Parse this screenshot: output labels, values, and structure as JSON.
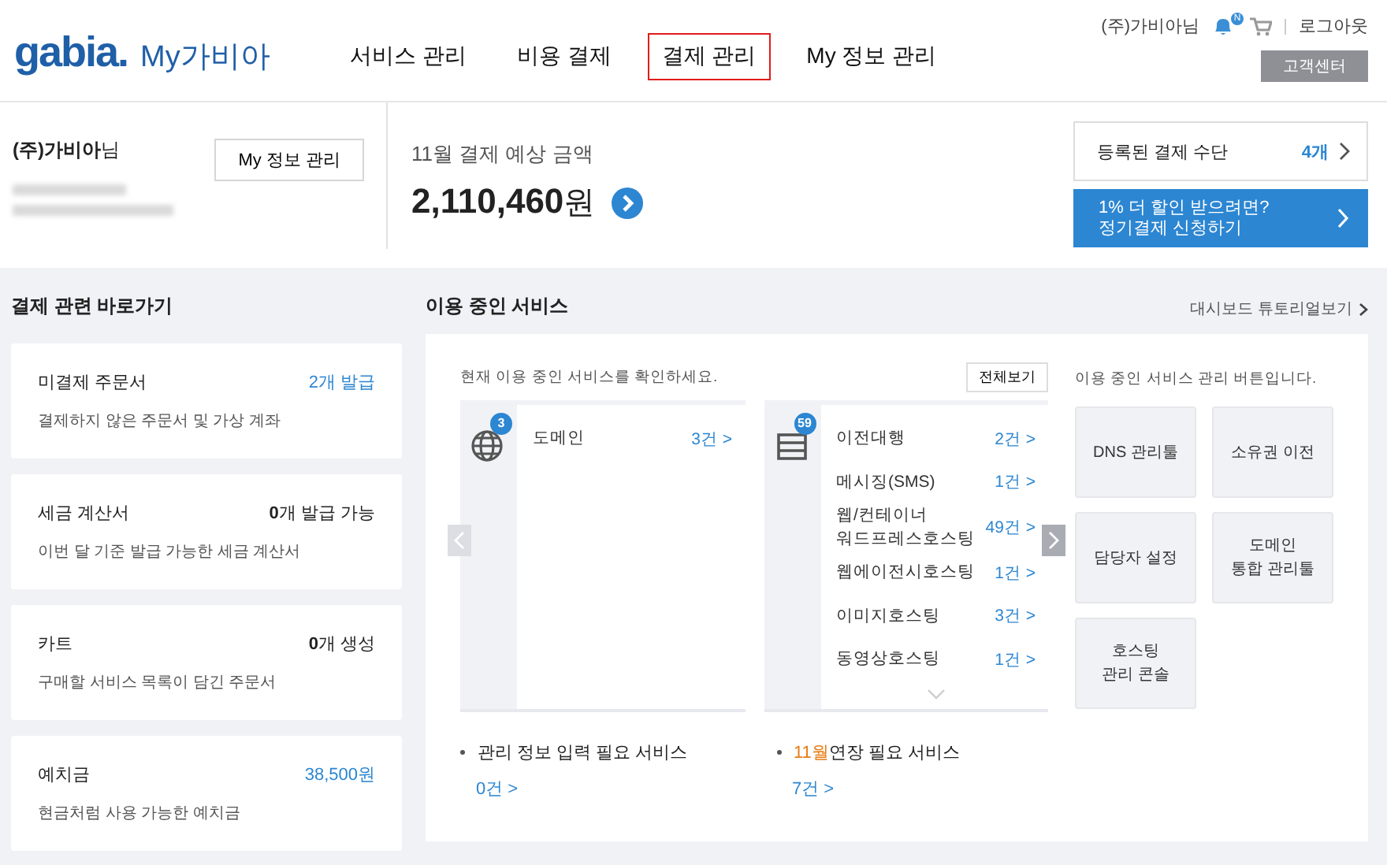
{
  "header": {
    "logo": "gabia.",
    "site_title": "My가비아",
    "nav": [
      {
        "label": "서비스 관리",
        "selected": false
      },
      {
        "label": "비용 결제",
        "selected": false
      },
      {
        "label": "결제 관리",
        "selected": true
      },
      {
        "label": "My 정보 관리",
        "selected": false
      }
    ],
    "user": "(주)가비아님",
    "bell_badge": "N",
    "logout": "로그아웃",
    "support": "고객센터"
  },
  "summary": {
    "user_name": "**(주)가비아**님",
    "profile_button": "My 정보 관리",
    "estimate_label": "11월 결제 예상 금액",
    "amount": "2,110,460",
    "currency": "원",
    "payment_methods": {
      "label": "등록된 결제 수단",
      "count": "4개"
    },
    "promo": {
      "line1": "1% 더 할인 받으려면?",
      "line2": "정기결제 신청하기"
    }
  },
  "shortcuts": {
    "title": "결제 관련 바로가기",
    "cards": [
      {
        "title": "미결제 주문서",
        "value": "2개 발급",
        "accent": true,
        "desc": "결제하지 않은 주문서 및 가상 계좌"
      },
      {
        "title": "세금 계산서",
        "value": "**0**개 발급 가능",
        "accent": false,
        "desc": "이번 달 기준 발급 가능한 세금 계산서"
      },
      {
        "title": "카트",
        "value": "**0**개 생성",
        "accent": false,
        "desc": "구매할 서비스 목록이 담긴 주문서"
      },
      {
        "title": "예치금",
        "value": "38,500원",
        "accent": true,
        "desc": "현금처럼 사용 가능한 예치금"
      }
    ]
  },
  "services": {
    "title": "이용 중인 서비스",
    "tutorial_link": "대시보드 튜토리얼보기",
    "intro": "현재 이용 중인 서비스를 확인하세요.",
    "view_all": "전체보기",
    "prev_disabled": true,
    "next_disabled": false,
    "groups": [
      {
        "kind": "globe",
        "badge": "3",
        "items": [
          {
            "name": "도메인",
            "count": "3건 >"
          }
        ]
      },
      {
        "kind": "server",
        "badge": "59",
        "more": true,
        "items": [
          {
            "name": "이전대행",
            "count": "2건 >"
          },
          {
            "name": "메시징(SMS)",
            "count": "1건 >"
          },
          {
            "name": "웹/컨테이너\n워드프레스호스팅",
            "count": "49건 >"
          },
          {
            "name": "웹에이전시호스팅",
            "count": "1건 >"
          },
          {
            "name": "이미지호스팅",
            "count": "3건 >"
          },
          {
            "name": "동영상호스팅",
            "count": "1건 >"
          }
        ]
      }
    ],
    "notices": [
      {
        "label": "관리 정보 입력 필요 서비스",
        "count": "0건 >"
      },
      {
        "month": "11월",
        "label": "연장 필요 서비스",
        "count": "7건 >"
      }
    ],
    "tools_intro": "이용 중인 서비스 관리 버튼입니다.",
    "tool_rows": [
      [
        "DNS 관리툴",
        "소유권 이전"
      ],
      [
        "담당자 설정",
        "도메인\n통합 관리툴"
      ],
      [
        "호스팅\n관리 콘솔"
      ]
    ]
  }
}
